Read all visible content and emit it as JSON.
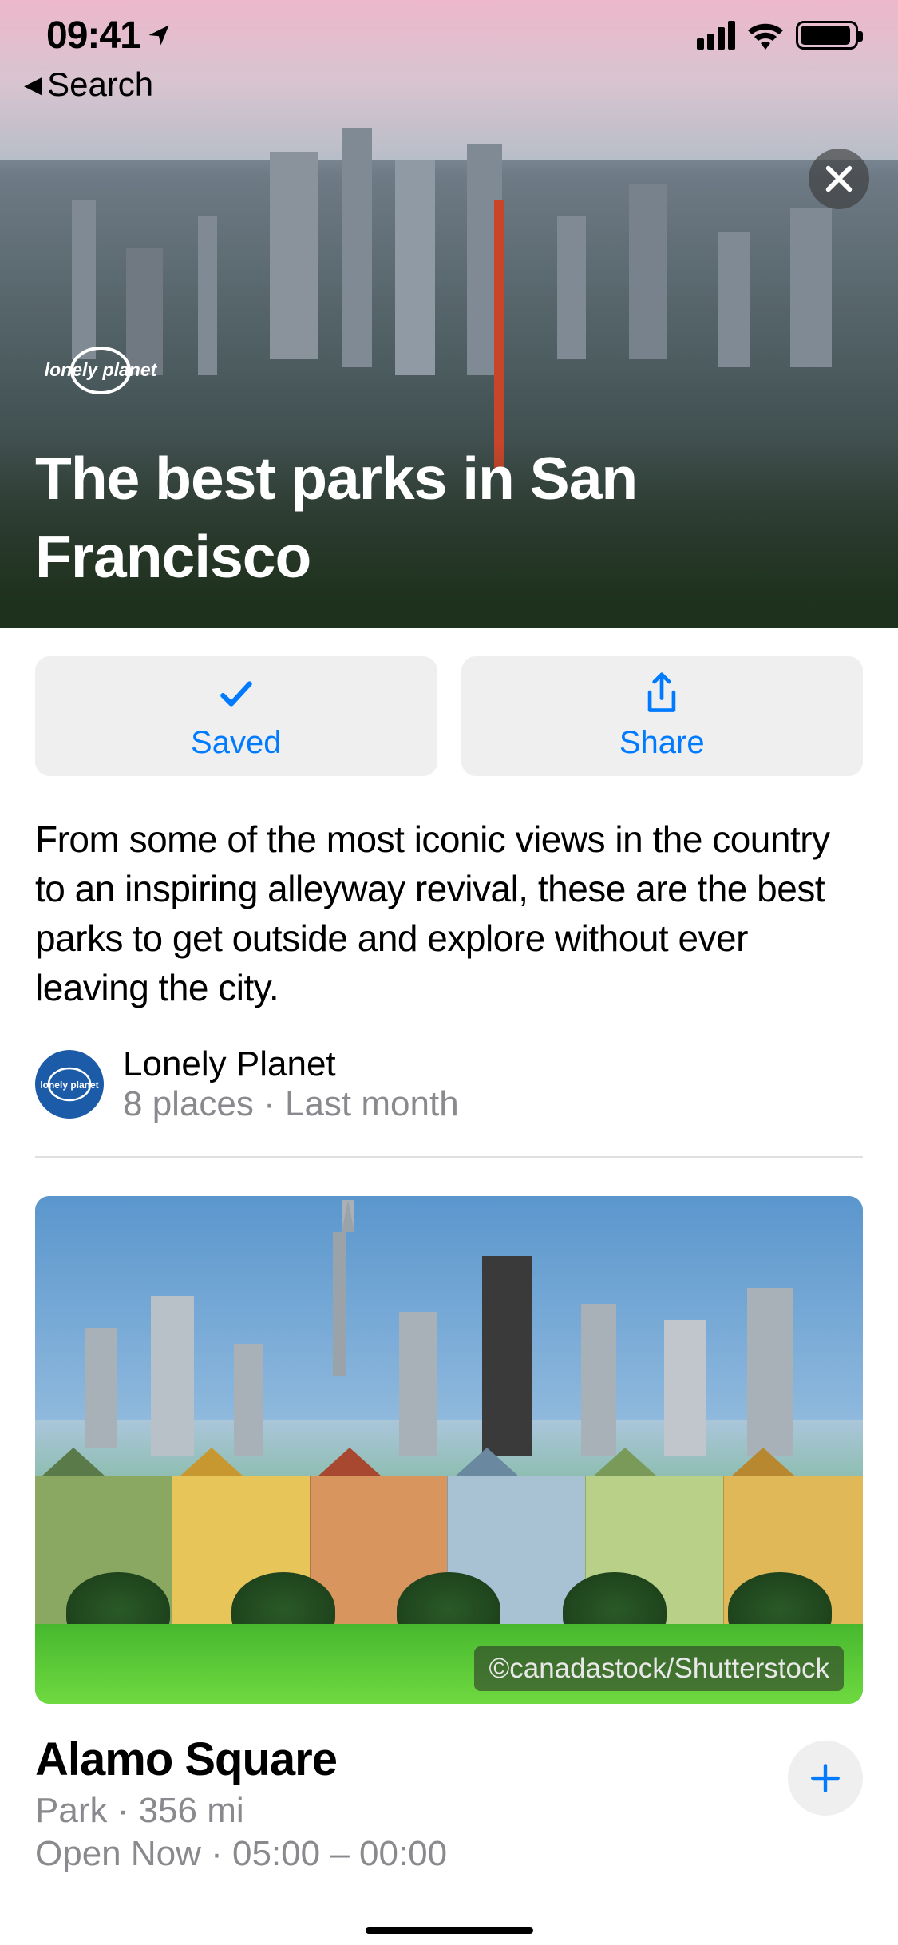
{
  "status": {
    "time": "09:41"
  },
  "nav": {
    "back_label": "Search"
  },
  "hero": {
    "brand": "lonely planet",
    "title": "The best parks in San Francisco"
  },
  "actions": {
    "saved_label": "Saved",
    "share_label": "Share"
  },
  "description": "From some of the most iconic views in the country to an inspiring alleyway revival, these are the best parks to get outside and explore without ever leaving the city.",
  "author": {
    "name": "Lonely Planet",
    "meta": "8 places · Last month"
  },
  "place": {
    "name": "Alamo Square",
    "meta": "Park · 356 mi",
    "hours": "Open Now · 05:00 – 00:00",
    "image_credit": "©canadastock/Shutterstock"
  },
  "colors": {
    "accent": "#007aff"
  }
}
